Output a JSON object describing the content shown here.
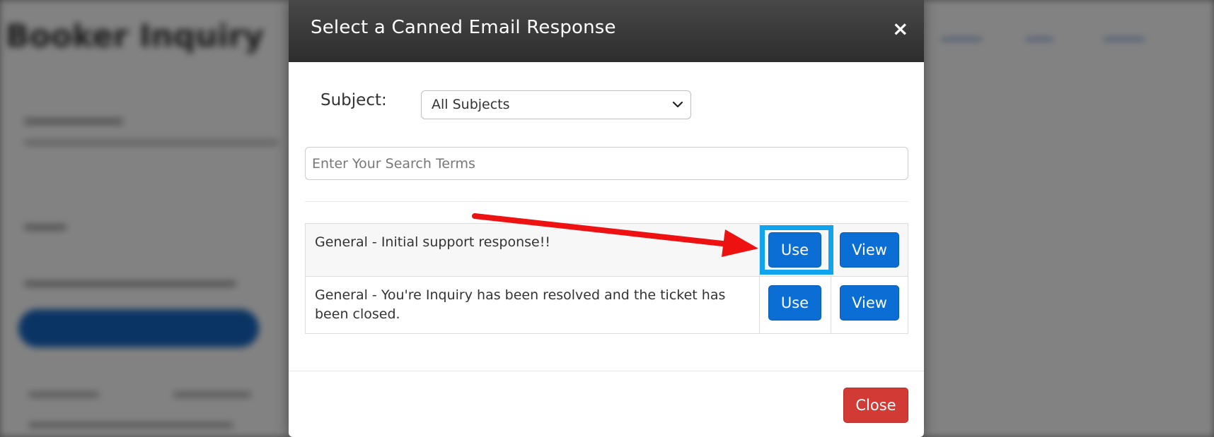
{
  "background": {
    "page_title": "Booker Inquiry"
  },
  "modal": {
    "title": "Select a Canned Email Response",
    "close_icon": "×",
    "subject_label": "Subject:",
    "subject_selected": "All Subjects",
    "search_placeholder": "Enter Your Search Terms",
    "search_value": "",
    "responses": [
      {
        "text": "General - Initial support response!!",
        "use_label": "Use",
        "view_label": "View"
      },
      {
        "text": "General - You're Inquiry has been resolved and the ticket has been closed.",
        "use_label": "Use",
        "view_label": "View"
      }
    ],
    "close_button": "Close"
  },
  "colors": {
    "header": "#343434",
    "primary_button": "#0b6ed4",
    "danger_button": "#d23a35",
    "highlight": "#10a3ee",
    "arrow": "#ee1111"
  }
}
